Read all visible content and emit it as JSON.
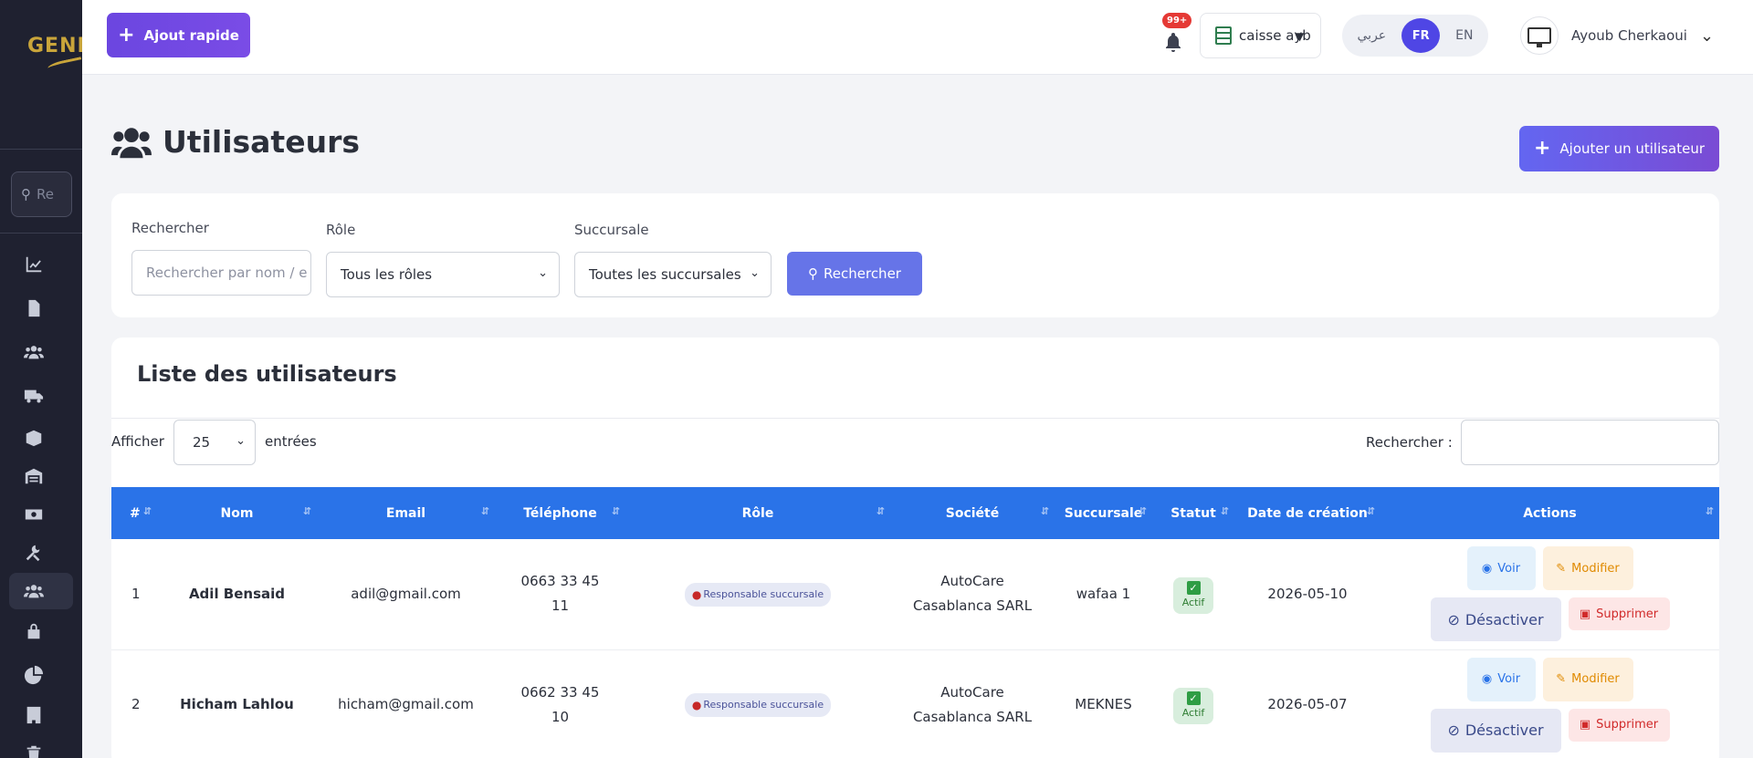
{
  "sidebar": {
    "logo_text": "GENIS",
    "search_placeholder": "Re",
    "items": [
      {
        "icon": "chart-line-icon"
      },
      {
        "icon": "file-icon"
      },
      {
        "icon": "users-icon"
      },
      {
        "icon": "truck-icon"
      },
      {
        "icon": "box-icon"
      },
      {
        "icon": "warehouse-icon"
      },
      {
        "icon": "money-icon"
      },
      {
        "icon": "tools-icon"
      },
      {
        "icon": "users-icon",
        "active": true
      },
      {
        "icon": "lock-icon"
      },
      {
        "icon": "pie-chart-icon"
      },
      {
        "icon": "building-icon"
      },
      {
        "icon": "trash-icon"
      }
    ]
  },
  "topbar": {
    "quick_add_label": "Ajout rapide",
    "notif_count": "99+",
    "branch_label": "caisse ayb",
    "lang_ar": "عربي",
    "lang_fr": "FR",
    "lang_en": "EN",
    "user_name": "Ayoub Cherkaoui"
  },
  "page": {
    "title": "Utilisateurs",
    "add_user_label": "Ajouter un utilisateur"
  },
  "filters": {
    "search_label": "Rechercher",
    "search_placeholder": "Rechercher par nom / e",
    "role_label": "Rôle",
    "role_value": "Tous les rôles",
    "branch_label": "Succursale",
    "branch_value": "Toutes les succursales",
    "search_button": "Rechercher"
  },
  "list": {
    "title": "Liste des utilisateurs",
    "show_label": "Afficher",
    "page_size": "25",
    "entries_label": "entrées",
    "search_label": "Rechercher :",
    "columns": [
      "#",
      "Nom",
      "Email",
      "Téléphone",
      "Rôle",
      "Société",
      "Succursale",
      "Statut",
      "Date de création",
      "Actions"
    ],
    "rows": [
      {
        "index": "1",
        "name": "Adil Bensaid",
        "email": "adil@gmail.com",
        "phone_1": "0663 33 45",
        "phone_2": "11",
        "role": "Responsable succursale",
        "company_1": "AutoCare",
        "company_2": "Casablanca SARL",
        "branch": "wafaa 1",
        "status": "Actif",
        "created": "2026-05-10"
      },
      {
        "index": "2",
        "name": "Hicham Lahlou",
        "email": "hicham@gmail.com",
        "phone_1": "0662 33 45",
        "phone_2": "10",
        "role": "Responsable succursale",
        "company_1": "AutoCare",
        "company_2": "Casablanca SARL",
        "branch": "MEKNES",
        "status": "Actif",
        "created": "2026-05-07"
      }
    ],
    "actions": {
      "view": "Voir",
      "edit": "Modifier",
      "deactivate": "Désactiver",
      "delete": "Supprimer"
    }
  },
  "colors": {
    "accent": "#6b46e0",
    "table_header": "#2a73e8",
    "sidebar_bg": "#1f2130"
  }
}
